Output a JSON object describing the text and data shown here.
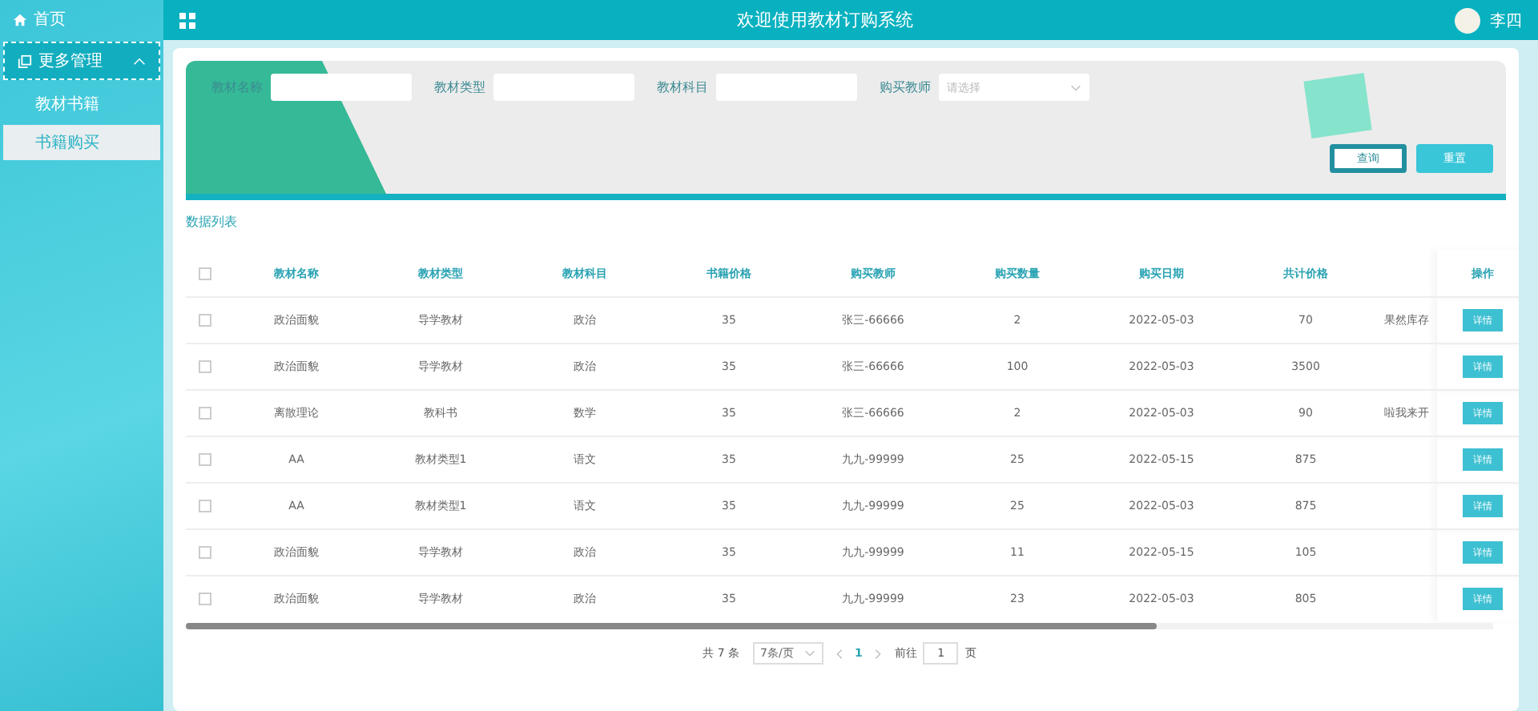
{
  "sidebar": {
    "items": [
      {
        "label": "首页"
      },
      {
        "label": "更多管理",
        "expanded": true,
        "children": [
          {
            "label": "教材书籍",
            "selected": false
          },
          {
            "label": "书籍购买",
            "selected": true
          }
        ]
      }
    ]
  },
  "header": {
    "title": "欢迎使用教材订购系统",
    "user": "李四"
  },
  "search": {
    "fields": [
      {
        "label": "教材名称",
        "kind": "input"
      },
      {
        "label": "教材类型",
        "kind": "input"
      },
      {
        "label": "教材科目",
        "kind": "input"
      },
      {
        "label": "购买教师",
        "kind": "select",
        "placeholder": "请选择"
      }
    ],
    "buttons": [
      {
        "label": "查询",
        "kind": "primary"
      },
      {
        "label": "重置",
        "kind": "secondary"
      }
    ]
  },
  "list_title": "数据列表",
  "table": {
    "header_checked": false,
    "columns": [
      "教材名称",
      "教材类型",
      "教材科目",
      "书籍价格",
      "购买教师",
      "购买数量",
      "购买日期",
      "共计价格",
      "",
      "操作"
    ],
    "rows": [
      {
        "checked": false,
        "cells": [
          "政治面貌",
          "导学教材",
          "政治",
          "35",
          "张三-66666",
          "2",
          "2022-05-03",
          "70",
          "果然库存"
        ],
        "action": "详情"
      },
      {
        "checked": false,
        "cells": [
          "政治面貌",
          "导学教材",
          "政治",
          "35",
          "张三-66666",
          "100",
          "2022-05-03",
          "3500",
          ""
        ],
        "action": "详情"
      },
      {
        "checked": false,
        "cells": [
          "离散理论",
          "教科书",
          "数学",
          "35",
          "张三-66666",
          "2",
          "2022-05-03",
          "90",
          "啦我来开"
        ],
        "action": "详情"
      },
      {
        "checked": false,
        "cells": [
          "AA",
          "教材类型1",
          "语文",
          "35",
          "九九-99999",
          "25",
          "2022-05-15",
          "875",
          ""
        ],
        "action": "详情"
      },
      {
        "checked": false,
        "cells": [
          "AA",
          "教材类型1",
          "语文",
          "35",
          "九九-99999",
          "25",
          "2022-05-03",
          "875",
          ""
        ],
        "action": "详情"
      },
      {
        "checked": false,
        "cells": [
          "政治面貌",
          "导学教材",
          "政治",
          "35",
          "九九-99999",
          "11",
          "2022-05-15",
          "105",
          ""
        ],
        "action": "详情"
      },
      {
        "checked": false,
        "cells": [
          "政治面貌",
          "导学教材",
          "政治",
          "35",
          "九九-99999",
          "23",
          "2022-05-03",
          "805",
          ""
        ],
        "action": "详情"
      }
    ]
  },
  "pagination": {
    "total": "共 7 条",
    "page_size": "7条/页",
    "pages": [
      {
        "label": "1",
        "selected": true
      }
    ],
    "goto_label": "前往",
    "goto_value": "1",
    "goto_unit": "页"
  }
}
